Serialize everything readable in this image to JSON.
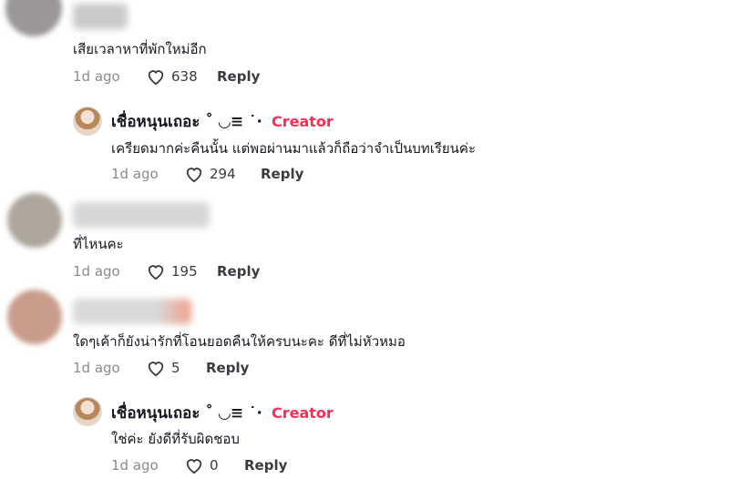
{
  "comments": [
    {
      "text": "เสียเวลาหาที่พักใหม่อีก",
      "ago": "1d ago",
      "likes": "638",
      "reply": "Reply"
    },
    {
      "text": "ที่ไหนคะ",
      "ago": "1d ago",
      "likes": "195",
      "reply": "Reply"
    },
    {
      "text": "ใดๆเค้าก็ยังน่ารักที่โอนยอดคืนให้ครบนะคะ ดีที่ไม่หัวหมอ",
      "ago": "1d ago",
      "likes": "5",
      "reply": "Reply"
    }
  ],
  "replies": [
    {
      "name": "เชื่อหนุนเถอะ ˚ ◡≡ ˙·",
      "badge": "Creator",
      "text": "เครียดมากค่ะคืนนั้น แต่พอผ่านมาแล้วก็ถือว่าจำเป็นบทเรียนค่ะ",
      "ago": "1d ago",
      "likes": "294",
      "reply": "Reply"
    },
    {
      "name": "เชื่อหนุนเถอะ ˚ ◡≡ ˙·",
      "badge": "Creator",
      "text": "ใช่ค่ะ ยังดีที่รับผิดชอบ",
      "ago": "1d ago",
      "likes": "0",
      "reply": "Reply"
    }
  ],
  "colors": {
    "creator": "#fe2c55",
    "muted": "#8a8b91"
  },
  "icons": {
    "like": "heart-outline-icon"
  }
}
